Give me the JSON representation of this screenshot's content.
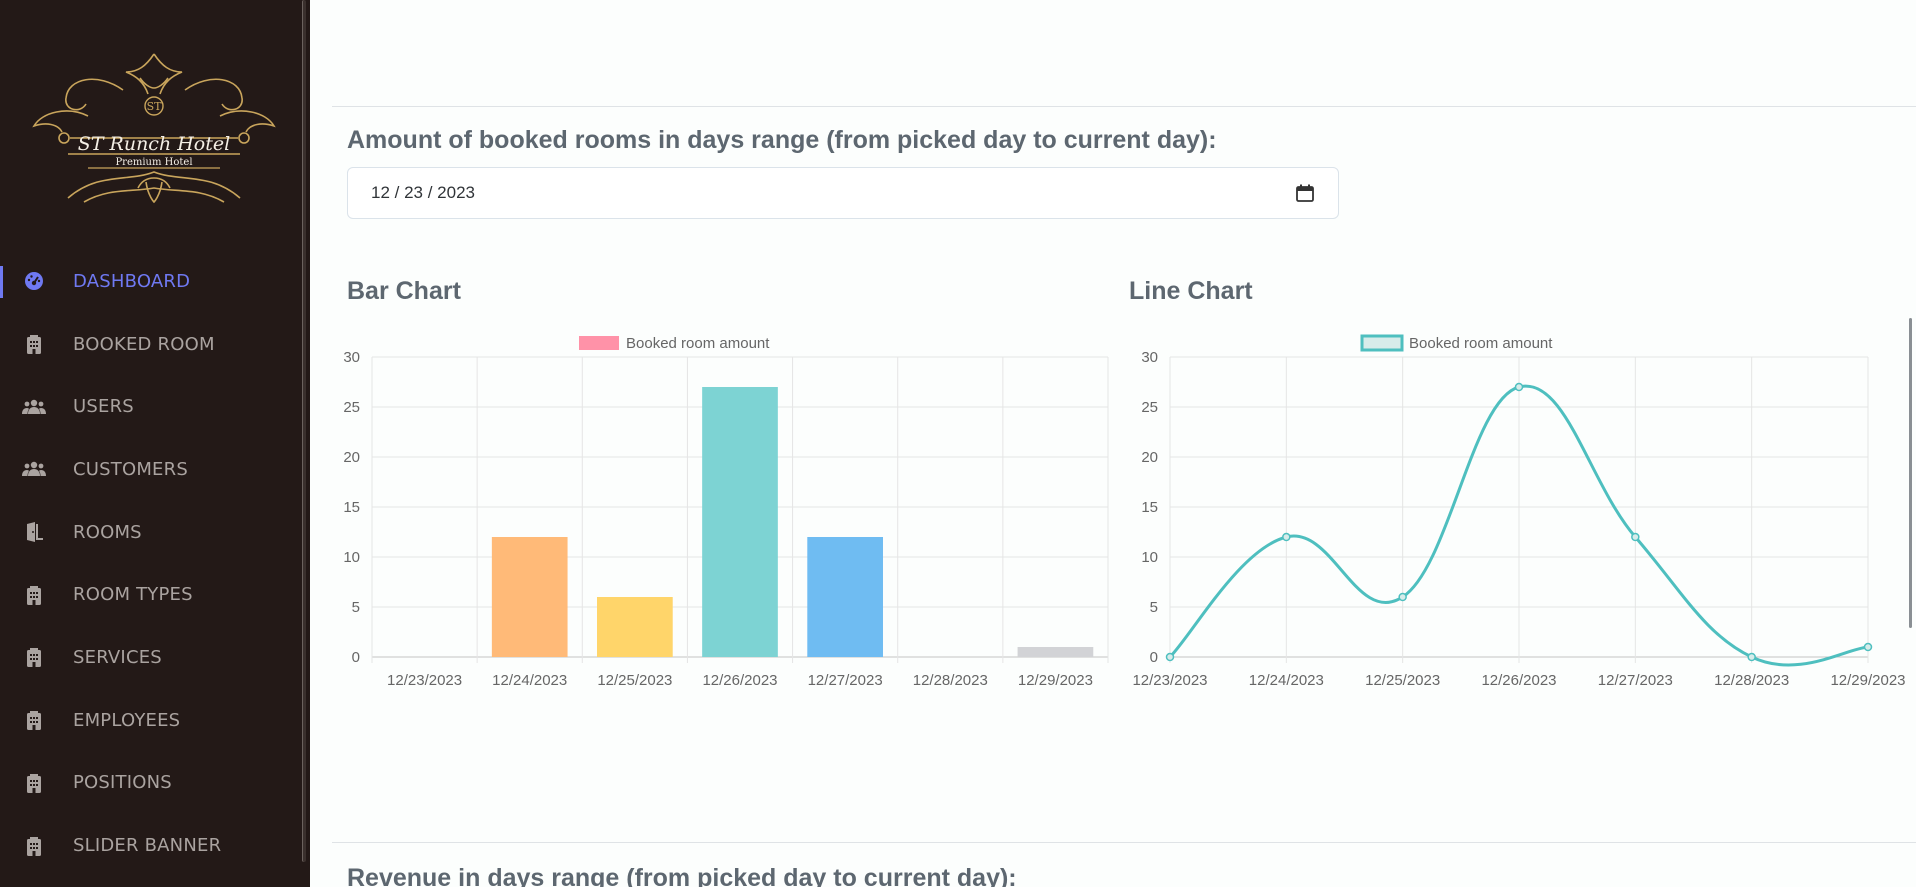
{
  "brand": {
    "monogram": "ST",
    "name": "ST Runch Hotel",
    "tagline": "Premium Hotel"
  },
  "sidebar": {
    "items": [
      {
        "label": "DASHBOARD",
        "icon": "dashboard-icon",
        "active": true
      },
      {
        "label": "BOOKED ROOM",
        "icon": "building-icon"
      },
      {
        "label": "USERS",
        "icon": "users-icon"
      },
      {
        "label": "CUSTOMERS",
        "icon": "users-icon"
      },
      {
        "label": "ROOMS",
        "icon": "door-icon"
      },
      {
        "label": "ROOM TYPES",
        "icon": "building-icon"
      },
      {
        "label": "SERVICES",
        "icon": "building-icon"
      },
      {
        "label": "EMPLOYEES",
        "icon": "building-icon"
      },
      {
        "label": "POSITIONS",
        "icon": "building-icon"
      },
      {
        "label": "SLIDER BANNER",
        "icon": "building-icon"
      }
    ]
  },
  "main": {
    "booked_section_title": "Amount of booked rooms in days range (from picked day to current day):",
    "date_value": "12 / 23 / 2023",
    "bar_chart_title": "Bar Chart",
    "line_chart_title": "Line Chart",
    "revenue_section_title": "Revenue in days range (from picked day to current day):"
  },
  "chart_data": [
    {
      "type": "bar",
      "title": "Bar Chart",
      "legend": "Booked room amount",
      "legend_color": "#ff92a8",
      "categories": [
        "12/23/2023",
        "12/24/2023",
        "12/25/2023",
        "12/26/2023",
        "12/27/2023",
        "12/28/2023",
        "12/29/2023"
      ],
      "values": [
        0,
        12,
        6,
        27,
        12,
        0,
        1
      ],
      "colors": [
        "#ff92a8",
        "#ffba78",
        "#ffd56a",
        "#7dd3d3",
        "#6fbcf2",
        "#b59cf8",
        "#d2d3d6"
      ],
      "ylim": [
        0,
        30
      ],
      "yticks": [
        0,
        5,
        10,
        15,
        20,
        25,
        30
      ],
      "grid": true,
      "legend_position": "top"
    },
    {
      "type": "line",
      "title": "Line Chart",
      "legend": "Booked room amount",
      "line_color": "#4ebfbf",
      "categories": [
        "12/23/2023",
        "12/24/2023",
        "12/25/2023",
        "12/26/2023",
        "12/27/2023",
        "12/28/2023",
        "12/29/2023"
      ],
      "values": [
        0,
        12,
        6,
        27,
        12,
        0,
        1
      ],
      "ylim": [
        0,
        30
      ],
      "yticks": [
        0,
        5,
        10,
        15,
        20,
        25,
        30
      ],
      "grid": true,
      "legend_position": "top"
    }
  ]
}
